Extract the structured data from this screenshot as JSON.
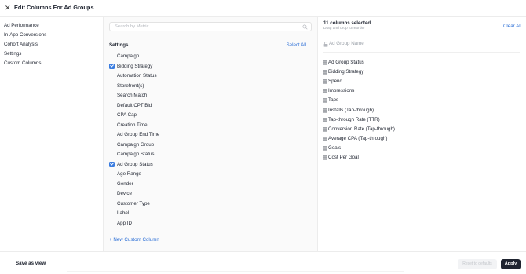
{
  "header": {
    "close_glyph": "✕",
    "title": "Edit Columns For Ad Groups"
  },
  "left_nav": {
    "items": [
      {
        "label": "Ad Performance"
      },
      {
        "label": "In-App Conversions"
      },
      {
        "label": "Cohort Analysis"
      },
      {
        "label": "Settings"
      },
      {
        "label": "Custom Columns"
      }
    ]
  },
  "middle": {
    "search": {
      "placeholder": "Search by Metric"
    },
    "section_title": "Settings",
    "select_all": "Select All",
    "options": [
      {
        "label": "Campaign",
        "checked": false
      },
      {
        "label": "Bidding Strategy",
        "checked": true
      },
      {
        "label": "Automation Status",
        "checked": false
      },
      {
        "label": "Storefront(s)",
        "checked": false
      },
      {
        "label": "Search Match",
        "checked": false
      },
      {
        "label": "Default CPT Bid",
        "checked": false
      },
      {
        "label": "CPA Cap",
        "checked": false
      },
      {
        "label": "Creation Time",
        "checked": false
      },
      {
        "label": "Ad Group End Time",
        "checked": false
      },
      {
        "label": "Campaign Group",
        "checked": false
      },
      {
        "label": "Campaign Status",
        "checked": false
      },
      {
        "label": "Ad Group Status",
        "checked": true
      },
      {
        "label": "Age Range",
        "checked": false
      },
      {
        "label": "Gender",
        "checked": false
      },
      {
        "label": "Device",
        "checked": false
      },
      {
        "label": "Customer Type",
        "checked": false
      },
      {
        "label": "Label",
        "checked": false
      },
      {
        "label": "App ID",
        "checked": false
      }
    ],
    "new_custom_column": "+ New Custom Column"
  },
  "right": {
    "selected_count": "11 columns selected",
    "drag_hint": "Drag and drop to reorder",
    "clear_all": "Clear All",
    "pinned": "Ad Group Name",
    "columns": [
      {
        "label": "Ad Group Status"
      },
      {
        "label": "Bidding Strategy"
      },
      {
        "label": "Spend"
      },
      {
        "label": "Impressions"
      },
      {
        "label": "Taps"
      },
      {
        "label": "Installs (Tap-through)"
      },
      {
        "label": "Tap-through Rate (TTR)"
      },
      {
        "label": "Conversion Rate (Tap-through)"
      },
      {
        "label": "Average CPA (Tap-through)"
      },
      {
        "label": "Goals"
      },
      {
        "label": "Cost Per Goal"
      }
    ]
  },
  "footer": {
    "save_as_view": "Save as view",
    "reset": "Reset to defaults",
    "apply": "Apply"
  },
  "icons": {
    "close": "close-icon",
    "search": "search-icon",
    "lock": "lock-icon",
    "drag": "drag-handle-icon"
  },
  "colors": {
    "accent": "#2c6fd6",
    "checkbox": "#3b7de0",
    "apply_button": "#1f2430"
  }
}
